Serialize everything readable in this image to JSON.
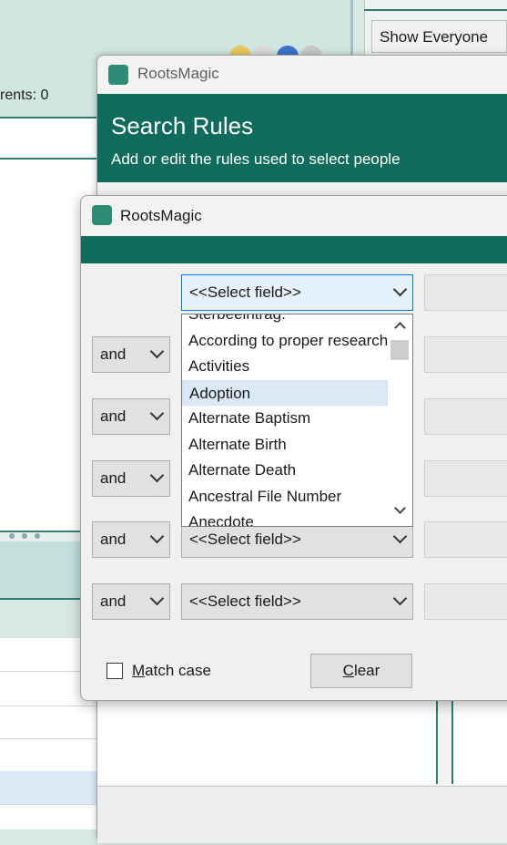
{
  "background": {
    "parents_label": "rents: 0",
    "show_everyone_label": "Show Everyone"
  },
  "search_rules": {
    "window_title": "RootsMagic",
    "heading": "Search Rules",
    "subheading": "Add or edit the rules used to select people"
  },
  "dialog": {
    "window_title": "RootsMagic",
    "rows": [
      {
        "connector": "",
        "field": "<<Select field>>"
      },
      {
        "connector": "and",
        "field": ""
      },
      {
        "connector": "and",
        "field": ""
      },
      {
        "connector": "and",
        "field": ""
      },
      {
        "connector": "and",
        "field": "<<Select field>>"
      },
      {
        "connector": "and",
        "field": "<<Select field>>"
      }
    ],
    "dropdown": {
      "items": [
        "Sterbeeintrag.",
        "According to proper research",
        "Activities",
        "Adoption",
        "Alternate Baptism",
        "Alternate Birth",
        "Alternate Death",
        "Ancestral File Number",
        "Anecdote"
      ],
      "selected": "Adoption"
    },
    "match_case_label_first": "M",
    "match_case_label_rest": "atch case",
    "clear_label_first": "C",
    "clear_label_rest": "lear"
  }
}
